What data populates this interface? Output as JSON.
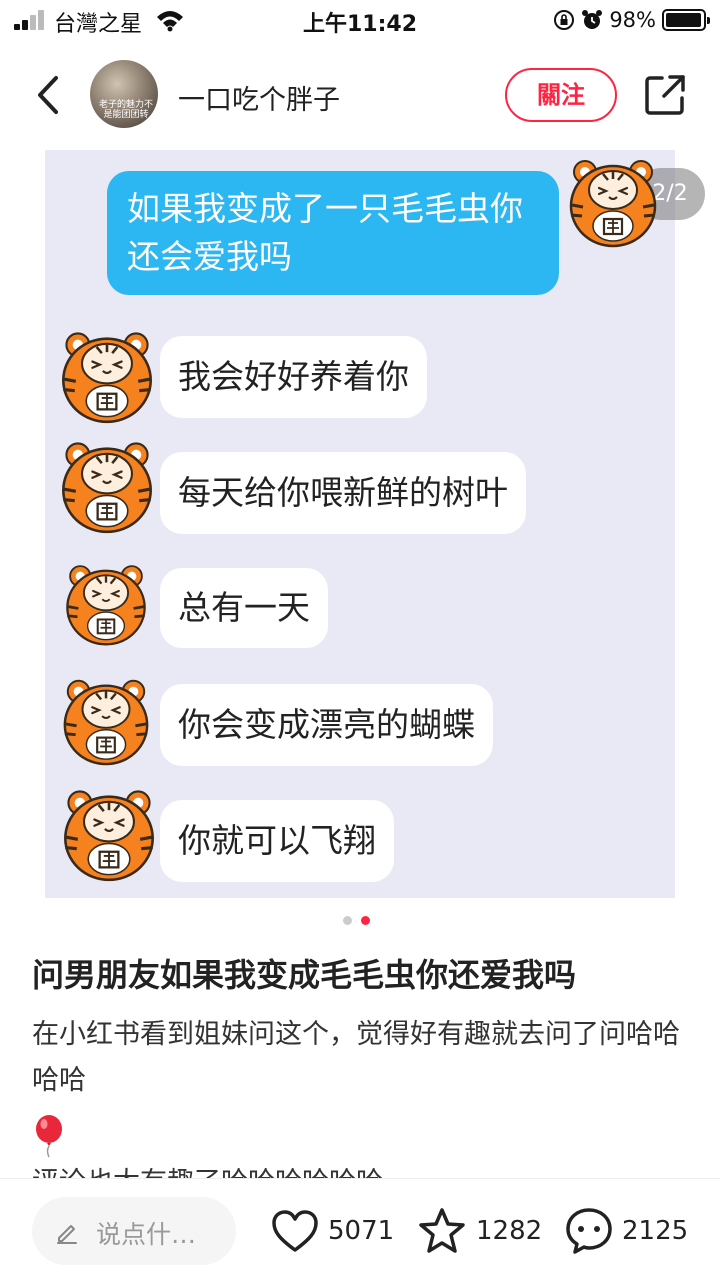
{
  "status_bar": {
    "carrier": "台灣之星",
    "time": "上午11:42",
    "battery": "98%",
    "battery_level": 0.98
  },
  "header": {
    "author_name": "一口吃个胖子",
    "avatar_caption": "老子的魅力不是能团团转",
    "follow_label": "關注"
  },
  "media": {
    "counter": "2/2",
    "chat_bg_color": "#e9e9f6",
    "messages": [
      {
        "side": "right",
        "text": "如果我变成了一只毛毛虫你还会爱我吗"
      },
      {
        "side": "left",
        "text": "我会好好养着你"
      },
      {
        "side": "left",
        "text": "每天给你喂新鲜的树叶"
      },
      {
        "side": "left",
        "text": "总有一天"
      },
      {
        "side": "left",
        "text": "你会变成漂亮的蝴蝶"
      },
      {
        "side": "left",
        "text": "你就可以飞翔"
      }
    ],
    "page_index": 2,
    "page_total": 2
  },
  "post": {
    "title": "问男朋友如果我变成毛毛虫你还爱我吗",
    "body": "在小红书看到姐妹问这个，觉得好有趣就去问了问哈哈哈哈",
    "cutoff_text": "评论也太有趣了哈哈哈哈哈哈"
  },
  "bottom_bar": {
    "comment_placeholder": "说点什…",
    "likes": "5071",
    "collects": "1282",
    "comments": "2125"
  },
  "colors": {
    "accent": "#ff2442",
    "my_bubble": "#2cb6f2",
    "tiger_orange": "#f5821f"
  }
}
